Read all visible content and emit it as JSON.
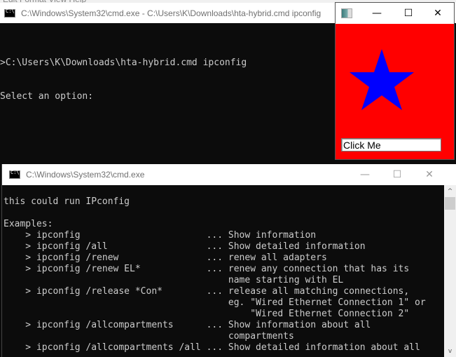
{
  "background_window": {
    "menu_fragment": "Edit   Format   View   Help"
  },
  "cmd_window_1": {
    "title": "C:\\Windows\\System32\\cmd.exe - C:\\Users\\K\\Downloads\\hta-hybrid.cmd  ipconfig",
    "lines": [
      ">C:\\Users\\K\\Downloads\\hta-hybrid.cmd ipconfig",
      "Select an option:"
    ]
  },
  "hta_window": {
    "icon": "hta-app-icon",
    "minimize": "—",
    "maximize": "☐",
    "close": "✕",
    "background_color": "#ff0000",
    "star_color": "#0000ff",
    "button_label": "Click Me"
  },
  "cmd_window_2": {
    "title": "C:\\Windows\\System32\\cmd.exe",
    "minimize": "—",
    "maximize": "☐",
    "close": "✕",
    "lines": [
      "this could run IPconfig",
      "",
      "Examples:",
      "    > ipconfig                       ... Show information",
      "    > ipconfig /all                  ... Show detailed information",
      "    > ipconfig /renew                ... renew all adapters",
      "    > ipconfig /renew EL*            ... renew any connection that has its",
      "                                         name starting with EL",
      "    > ipconfig /release *Con*        ... release all matching connections,",
      "                                         eg. \"Wired Ethernet Connection 1\" or",
      "                                             \"Wired Ethernet Connection 2\"",
      "    > ipconfig /allcompartments      ... Show information about all",
      "                                         compartments",
      "    > ipconfig /allcompartments /all ... Show detailed information about all"
    ],
    "scroll_up": "^",
    "scroll_down": "v"
  }
}
